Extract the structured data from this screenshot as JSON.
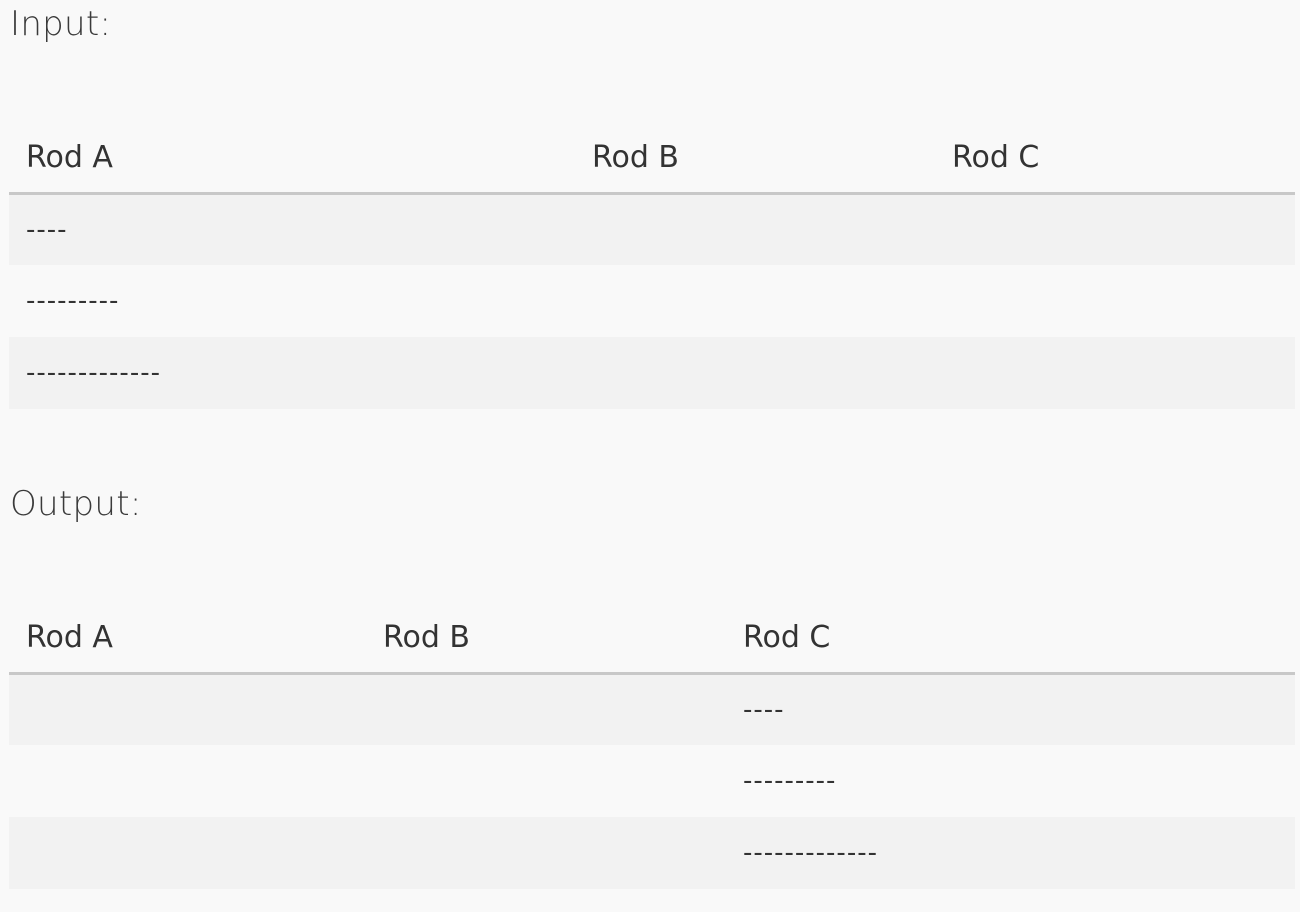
{
  "input": {
    "label": "Input:",
    "headers": [
      "Rod A",
      "Rod B",
      "Rod C"
    ],
    "rows": [
      [
        "----",
        "",
        ""
      ],
      [
        "---------",
        "",
        ""
      ],
      [
        "-------------",
        "",
        ""
      ]
    ]
  },
  "output": {
    "label": "Output:",
    "headers": [
      "Rod A",
      "Rod B",
      "Rod C"
    ],
    "rows": [
      [
        "",
        "",
        "----"
      ],
      [
        "",
        "",
        "---------"
      ],
      [
        "",
        "",
        "-------------"
      ]
    ]
  },
  "colors": {
    "background": "#f9f9f9",
    "row_stripe": "#f2f2f2",
    "header_rule": "#c8c8c8",
    "text": "#333333"
  }
}
